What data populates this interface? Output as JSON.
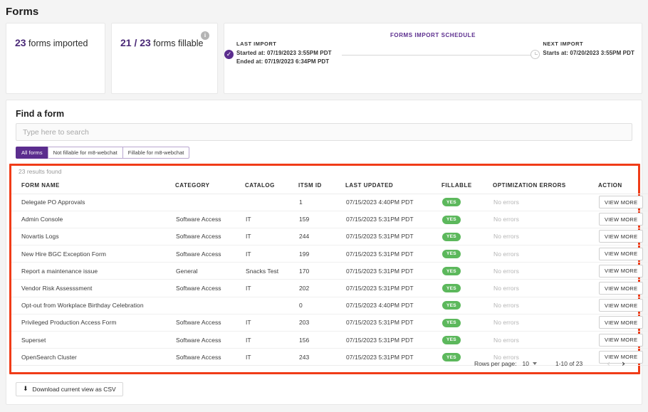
{
  "page": {
    "title": "Forms"
  },
  "cards": {
    "imported": {
      "number": "23",
      "text": " forms imported"
    },
    "fillable": {
      "number": "21 / 23",
      "text": " forms fillable",
      "info_icon": "info-icon"
    },
    "schedule": {
      "title": "FORMS IMPORT SCHEDULE",
      "last": {
        "label": "LAST IMPORT",
        "started": "Started at: 07/19/2023 3:55PM PDT",
        "ended": "Ended at: 07/19/2023 6:34PM PDT",
        "icon": "check-circle-icon"
      },
      "next": {
        "label": "NEXT IMPORT",
        "starts": "Starts at: 07/20/2023 3:55PM PDT",
        "icon": "clock-icon"
      }
    }
  },
  "find": {
    "title": "Find a form",
    "search_placeholder": "Type here to search",
    "search_value": "",
    "tabs": [
      {
        "label": "All forms",
        "active": true
      },
      {
        "label": "Not fillable for m8-webchat",
        "active": false
      },
      {
        "label": "Fillable for m8-webchat",
        "active": false
      }
    ],
    "results_count": "23 results found"
  },
  "table": {
    "headers": [
      "FORM NAME",
      "CATEGORY",
      "CATALOG",
      "ITSM ID",
      "LAST UPDATED",
      "FILLABLE",
      "OPTIMIZATION ERRORS",
      "ACTION"
    ],
    "action_label": "VIEW MORE",
    "rows": [
      {
        "name": "Delegate PO Approvals",
        "category": "",
        "catalog": "",
        "itsm_id": "1",
        "last_updated": "07/15/2023 4:40PM PDT",
        "fillable": "YES",
        "errors": "No errors"
      },
      {
        "name": "Admin Console",
        "category": "Software Access",
        "catalog": "IT",
        "itsm_id": "159",
        "last_updated": "07/15/2023 5:31PM PDT",
        "fillable": "YES",
        "errors": "No errors"
      },
      {
        "name": "Novartis Logs",
        "category": "Software Access",
        "catalog": "IT",
        "itsm_id": "244",
        "last_updated": "07/15/2023 5:31PM PDT",
        "fillable": "YES",
        "errors": "No errors"
      },
      {
        "name": "New Hire BGC Exception Form",
        "category": "Software Access",
        "catalog": "IT",
        "itsm_id": "199",
        "last_updated": "07/15/2023 5:31PM PDT",
        "fillable": "YES",
        "errors": "No errors"
      },
      {
        "name": "Report a maintenance issue",
        "category": "General",
        "catalog": "Snacks Test",
        "itsm_id": "170",
        "last_updated": "07/15/2023 5:31PM PDT",
        "fillable": "YES",
        "errors": "No errors"
      },
      {
        "name": "Vendor Risk Assesssment",
        "category": "Software Access",
        "catalog": "IT",
        "itsm_id": "202",
        "last_updated": "07/15/2023 5:31PM PDT",
        "fillable": "YES",
        "errors": "No errors"
      },
      {
        "name": "Opt-out from Workplace Birthday Celebration",
        "category": "",
        "catalog": "",
        "itsm_id": "0",
        "last_updated": "07/15/2023 4:40PM PDT",
        "fillable": "YES",
        "errors": "No errors"
      },
      {
        "name": "Privileged Production Access Form",
        "category": "Software Access",
        "catalog": "IT",
        "itsm_id": "203",
        "last_updated": "07/15/2023 5:31PM PDT",
        "fillable": "YES",
        "errors": "No errors"
      },
      {
        "name": "Superset",
        "category": "Software Access",
        "catalog": "IT",
        "itsm_id": "156",
        "last_updated": "07/15/2023 5:31PM PDT",
        "fillable": "YES",
        "errors": "No errors"
      },
      {
        "name": "OpenSearch Cluster",
        "category": "Software Access",
        "catalog": "IT",
        "itsm_id": "243",
        "last_updated": "07/15/2023 5:31PM PDT",
        "fillable": "YES",
        "errors": "No errors"
      }
    ]
  },
  "pagination": {
    "rows_per_page_label": "Rows per page:",
    "rows_per_page_value": "10",
    "range": "1-10 of 23",
    "prev_icon": "chevron-left-icon",
    "next_icon": "chevron-right-icon"
  },
  "footer": {
    "csv_label": "Download current view as CSV",
    "csv_icon": "download-icon"
  },
  "colors": {
    "accent_purple": "#5b2d8e",
    "stat_purple": "#4b2a78",
    "badge_green": "#5cb85c",
    "annotation_red": "#f03c18",
    "page_bg": "#f4f4f4"
  }
}
